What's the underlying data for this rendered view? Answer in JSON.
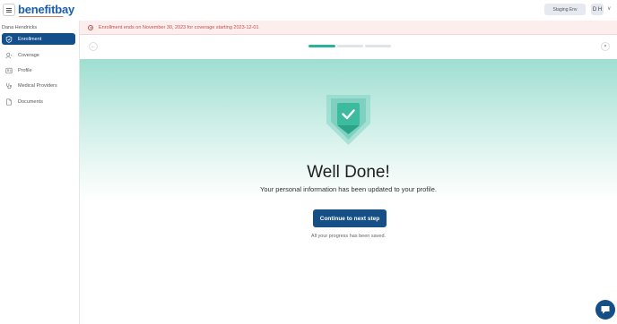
{
  "header": {
    "logo_text": "benefitbay",
    "environment_label": "Staging Env",
    "avatar_initials": "D H"
  },
  "sidebar": {
    "user_name": "Dana Hendricks",
    "items": [
      {
        "label": "Enrollment",
        "icon": "shield-check-icon",
        "active": true
      },
      {
        "label": "Coverage",
        "icon": "coverage-icon",
        "active": false
      },
      {
        "label": "Profile",
        "icon": "profile-card-icon",
        "active": false
      },
      {
        "label": "Medical Providers",
        "icon": "stethoscope-icon",
        "active": false
      },
      {
        "label": "Documents",
        "icon": "document-icon",
        "active": false
      }
    ]
  },
  "alert": {
    "text": "Enrollment ends on November 30, 2023 for coverage starting 2023-12-01"
  },
  "stepper": {
    "back_icon": "arrow-left-icon",
    "close_icon": "close-icon",
    "segments_total": 3,
    "segments_complete": 1
  },
  "main": {
    "title": "Well Done!",
    "subtitle": "Your personal information has been updated to your profile.",
    "cta_label": "Continue to next step",
    "saved_note": "All your progress has been saved."
  },
  "colors": {
    "brand_blue": "#154f85",
    "active_nav": "#134f8b",
    "progress_active": "#2bb39a",
    "progress_inactive": "#dfe3ea",
    "alert_text": "#c0504d",
    "alert_bg": "#fdeeee",
    "hero_teal": "#9fded1"
  }
}
